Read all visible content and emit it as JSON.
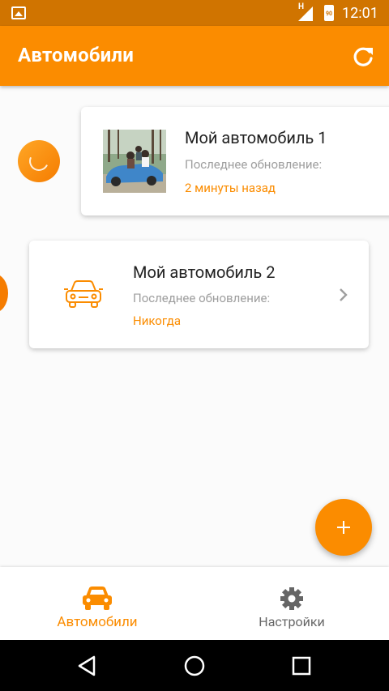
{
  "status_bar": {
    "time": "12:01",
    "network": "H",
    "battery": "90"
  },
  "app_bar": {
    "title": "Автомобили",
    "refresh_icon": "refresh-icon"
  },
  "cars": [
    {
      "name": "Мой автомобиль 1",
      "updated_label": "Последнее обновление:",
      "updated_value": "2 минуты назад"
    },
    {
      "name": "Мой автомобиль 2",
      "updated_label": "Последнее обновление:",
      "updated_value": "Никогда"
    }
  ],
  "fab": {
    "icon": "plus-icon"
  },
  "bottom_nav": {
    "items": [
      {
        "label": "Автомобили",
        "icon": "car-icon",
        "active": true
      },
      {
        "label": "Настройки",
        "icon": "gear-icon",
        "active": false
      }
    ]
  },
  "colors": {
    "accent": "#fb8c00",
    "status_bar": "#d07400",
    "text_primary": "#222222",
    "text_secondary": "#9e9e9e"
  }
}
